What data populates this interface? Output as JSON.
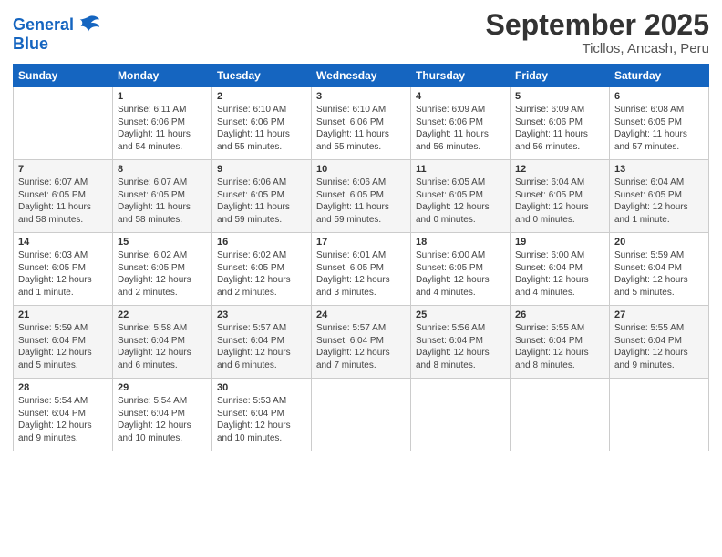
{
  "logo": {
    "line1": "General",
    "line2": "Blue"
  },
  "title": "September 2025",
  "subtitle": "Ticllos, Ancash, Peru",
  "headers": [
    "Sunday",
    "Monday",
    "Tuesday",
    "Wednesday",
    "Thursday",
    "Friday",
    "Saturday"
  ],
  "weeks": [
    [
      {
        "day": "",
        "text": ""
      },
      {
        "day": "1",
        "text": "Sunrise: 6:11 AM\nSunset: 6:06 PM\nDaylight: 11 hours\nand 54 minutes."
      },
      {
        "day": "2",
        "text": "Sunrise: 6:10 AM\nSunset: 6:06 PM\nDaylight: 11 hours\nand 55 minutes."
      },
      {
        "day": "3",
        "text": "Sunrise: 6:10 AM\nSunset: 6:06 PM\nDaylight: 11 hours\nand 55 minutes."
      },
      {
        "day": "4",
        "text": "Sunrise: 6:09 AM\nSunset: 6:06 PM\nDaylight: 11 hours\nand 56 minutes."
      },
      {
        "day": "5",
        "text": "Sunrise: 6:09 AM\nSunset: 6:06 PM\nDaylight: 11 hours\nand 56 minutes."
      },
      {
        "day": "6",
        "text": "Sunrise: 6:08 AM\nSunset: 6:05 PM\nDaylight: 11 hours\nand 57 minutes."
      }
    ],
    [
      {
        "day": "7",
        "text": "Sunrise: 6:07 AM\nSunset: 6:05 PM\nDaylight: 11 hours\nand 58 minutes."
      },
      {
        "day": "8",
        "text": "Sunrise: 6:07 AM\nSunset: 6:05 PM\nDaylight: 11 hours\nand 58 minutes."
      },
      {
        "day": "9",
        "text": "Sunrise: 6:06 AM\nSunset: 6:05 PM\nDaylight: 11 hours\nand 59 minutes."
      },
      {
        "day": "10",
        "text": "Sunrise: 6:06 AM\nSunset: 6:05 PM\nDaylight: 11 hours\nand 59 minutes."
      },
      {
        "day": "11",
        "text": "Sunrise: 6:05 AM\nSunset: 6:05 PM\nDaylight: 12 hours\nand 0 minutes."
      },
      {
        "day": "12",
        "text": "Sunrise: 6:04 AM\nSunset: 6:05 PM\nDaylight: 12 hours\nand 0 minutes."
      },
      {
        "day": "13",
        "text": "Sunrise: 6:04 AM\nSunset: 6:05 PM\nDaylight: 12 hours\nand 1 minute."
      }
    ],
    [
      {
        "day": "14",
        "text": "Sunrise: 6:03 AM\nSunset: 6:05 PM\nDaylight: 12 hours\nand 1 minute."
      },
      {
        "day": "15",
        "text": "Sunrise: 6:02 AM\nSunset: 6:05 PM\nDaylight: 12 hours\nand 2 minutes."
      },
      {
        "day": "16",
        "text": "Sunrise: 6:02 AM\nSunset: 6:05 PM\nDaylight: 12 hours\nand 2 minutes."
      },
      {
        "day": "17",
        "text": "Sunrise: 6:01 AM\nSunset: 6:05 PM\nDaylight: 12 hours\nand 3 minutes."
      },
      {
        "day": "18",
        "text": "Sunrise: 6:00 AM\nSunset: 6:05 PM\nDaylight: 12 hours\nand 4 minutes."
      },
      {
        "day": "19",
        "text": "Sunrise: 6:00 AM\nSunset: 6:04 PM\nDaylight: 12 hours\nand 4 minutes."
      },
      {
        "day": "20",
        "text": "Sunrise: 5:59 AM\nSunset: 6:04 PM\nDaylight: 12 hours\nand 5 minutes."
      }
    ],
    [
      {
        "day": "21",
        "text": "Sunrise: 5:59 AM\nSunset: 6:04 PM\nDaylight: 12 hours\nand 5 minutes."
      },
      {
        "day": "22",
        "text": "Sunrise: 5:58 AM\nSunset: 6:04 PM\nDaylight: 12 hours\nand 6 minutes."
      },
      {
        "day": "23",
        "text": "Sunrise: 5:57 AM\nSunset: 6:04 PM\nDaylight: 12 hours\nand 6 minutes."
      },
      {
        "day": "24",
        "text": "Sunrise: 5:57 AM\nSunset: 6:04 PM\nDaylight: 12 hours\nand 7 minutes."
      },
      {
        "day": "25",
        "text": "Sunrise: 5:56 AM\nSunset: 6:04 PM\nDaylight: 12 hours\nand 8 minutes."
      },
      {
        "day": "26",
        "text": "Sunrise: 5:55 AM\nSunset: 6:04 PM\nDaylight: 12 hours\nand 8 minutes."
      },
      {
        "day": "27",
        "text": "Sunrise: 5:55 AM\nSunset: 6:04 PM\nDaylight: 12 hours\nand 9 minutes."
      }
    ],
    [
      {
        "day": "28",
        "text": "Sunrise: 5:54 AM\nSunset: 6:04 PM\nDaylight: 12 hours\nand 9 minutes."
      },
      {
        "day": "29",
        "text": "Sunrise: 5:54 AM\nSunset: 6:04 PM\nDaylight: 12 hours\nand 10 minutes."
      },
      {
        "day": "30",
        "text": "Sunrise: 5:53 AM\nSunset: 6:04 PM\nDaylight: 12 hours\nand 10 minutes."
      },
      {
        "day": "",
        "text": ""
      },
      {
        "day": "",
        "text": ""
      },
      {
        "day": "",
        "text": ""
      },
      {
        "day": "",
        "text": ""
      }
    ]
  ]
}
